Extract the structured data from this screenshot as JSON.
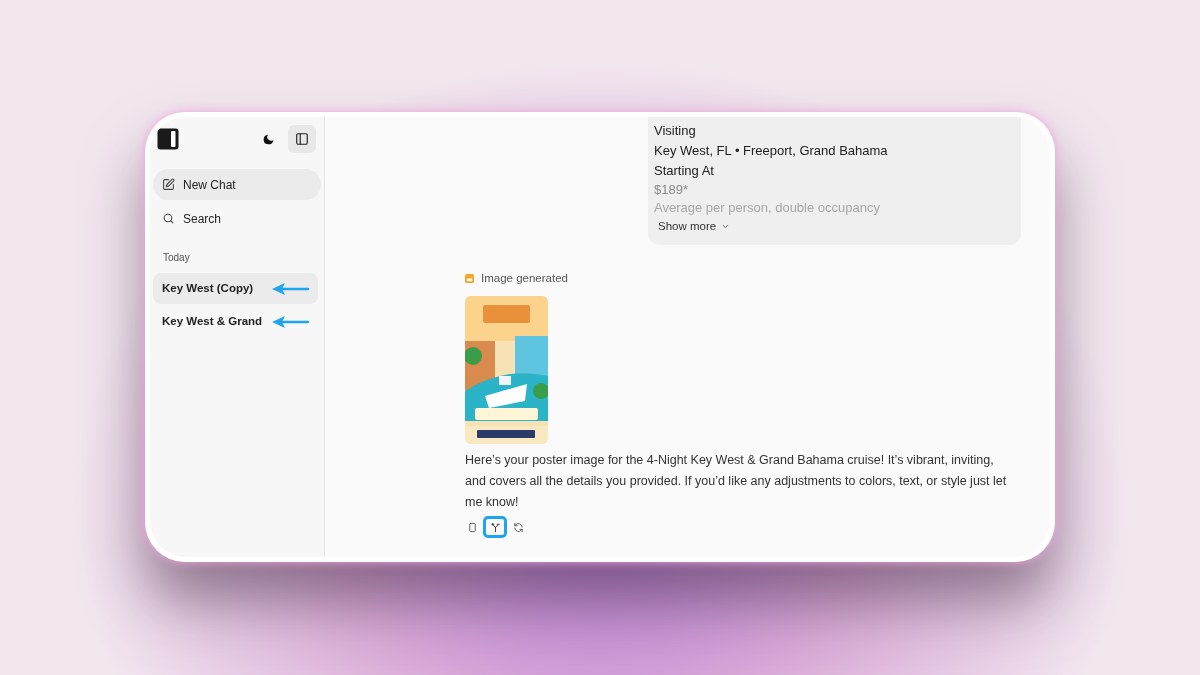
{
  "sidebar": {
    "new_chat": "New Chat",
    "search": "Search",
    "section": "Today",
    "items": [
      {
        "label": "Key West (Copy)",
        "selected": true,
        "pointed": true
      },
      {
        "label": "Key West & Grand",
        "selected": false,
        "pointed": true
      }
    ]
  },
  "user_message": {
    "lines": [
      "Visiting",
      "Key West, FL • Freeport, Grand Bahama",
      "Starting At"
    ],
    "faded_lines": [
      "$189*",
      "Average per person, double occupancy"
    ],
    "show_more": "Show more"
  },
  "assistant": {
    "status": "Image generated",
    "text": "Here’s your poster image for the 4-Night Key West & Grand Bahama cruise! It’s vibrant, inviting, and covers all the details you provided. If you’d like any adjustments to colors, text, or style just let me know!",
    "actions": [
      {
        "kind": "copy",
        "highlighted": false
      },
      {
        "kind": "branch",
        "highlighted": true
      },
      {
        "kind": "regenerate",
        "highlighted": false
      }
    ]
  }
}
